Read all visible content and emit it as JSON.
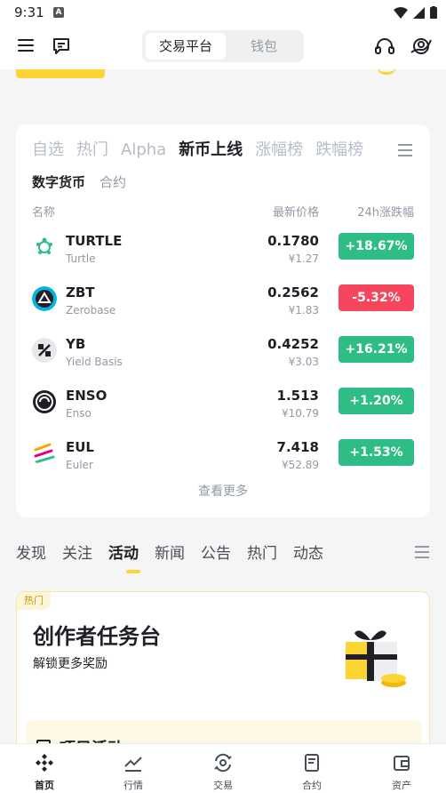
{
  "status_bar": {
    "time": "9:31",
    "notif_icon": "A"
  },
  "header": {
    "segments": [
      "交易平台",
      "钱包"
    ],
    "active_segment": "交易平台"
  },
  "market": {
    "tabs": [
      "自选",
      "热门",
      "Alpha",
      "新币上线",
      "涨幅榜",
      "跌幅榜"
    ],
    "active_tab": "新币上线",
    "sub_tabs": [
      "数字货币",
      "合约"
    ],
    "columns": {
      "name": "名称",
      "price": "最新价格",
      "change": "24h涨跌幅"
    },
    "rows": [
      {
        "symbol": "TURTLE",
        "name": "Turtle",
        "price": "0.1780",
        "cny": "¥1.27",
        "change": "+18.67%",
        "dir": "up",
        "icon": "turtle-icon"
      },
      {
        "symbol": "ZBT",
        "name": "Zerobase",
        "price": "0.2562",
        "cny": "¥1.83",
        "change": "-5.32%",
        "dir": "down",
        "icon": "zbt-icon"
      },
      {
        "symbol": "YB",
        "name": "Yield Basis",
        "price": "0.4252",
        "cny": "¥3.03",
        "change": "+16.21%",
        "dir": "up",
        "icon": "yb-icon"
      },
      {
        "symbol": "ENSO",
        "name": "Enso",
        "price": "1.513",
        "cny": "¥10.79",
        "change": "+1.20%",
        "dir": "up",
        "icon": "enso-icon"
      },
      {
        "symbol": "EUL",
        "name": "Euler",
        "price": "7.418",
        "cny": "¥52.89",
        "change": "+1.53%",
        "dir": "up",
        "icon": "eul-icon"
      }
    ],
    "more": "查看更多"
  },
  "feed": {
    "tabs": [
      "发现",
      "关注",
      "活动",
      "新闻",
      "公告",
      "热门",
      "动态"
    ],
    "active_tab": "活动"
  },
  "promo": {
    "badge": "热门",
    "title": "创作者任务台",
    "subtitle": "解锁更多奖励",
    "inner_title": "项目活动"
  },
  "bottom_nav": [
    {
      "label": "首页",
      "icon": "home-icon"
    },
    {
      "label": "行情",
      "icon": "markets-icon"
    },
    {
      "label": "交易",
      "icon": "trade-icon"
    },
    {
      "label": "合约",
      "icon": "futures-icon"
    },
    {
      "label": "资产",
      "icon": "wallet-icon"
    }
  ],
  "colors": {
    "accent": "#fcd535",
    "up": "#2ebd85",
    "down": "#f6465d"
  }
}
